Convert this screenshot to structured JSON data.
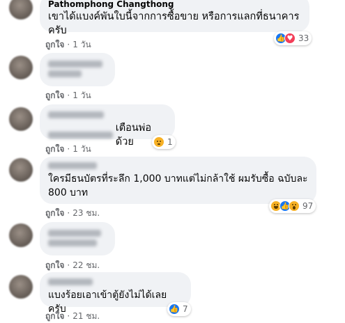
{
  "comments": [
    {
      "name": "Pathomphong Changthong",
      "text": "เขาได้แบงค์พันใบนี้จากการซื้อขาย หรือการแลกที่ธนาคารครับ",
      "like_label": "ถูกใจ",
      "time": "1 วัน",
      "reactions": [
        "like",
        "love"
      ],
      "reaction_count": "33"
    },
    {
      "name": "",
      "text": "",
      "like_label": "ถูกใจ",
      "time": "1 วัน"
    },
    {
      "name": "",
      "text": "เตือนพ่อด้วย",
      "like_label": "ถูกใจ",
      "time": "1 วัน",
      "reactions": [
        "sad"
      ],
      "reaction_count": "1"
    },
    {
      "name": "",
      "text": "ใครมีธนบัตรที่ระลึก 1,000 บาทแต่ไม่กล้าใช้ ผมรับซื้อ ฉบับละ 800 บาท",
      "like_label": "ถูกใจ",
      "time": "23 ชม.",
      "reactions": [
        "haha",
        "like",
        "wow"
      ],
      "reaction_count": "97"
    },
    {
      "name": "",
      "text": "",
      "like_label": "ถูกใจ",
      "time": "22 ชม."
    },
    {
      "name": "",
      "text": "แบงร้อยเอาเข้าตู้ยังไม่ได้เลยครับ",
      "like_label": "ถูกใจ",
      "time": "21 ชม.",
      "reactions": [
        "like"
      ],
      "reaction_count": "7"
    }
  ],
  "colors": {
    "bubble": "#f0f2f5",
    "meta": "#65676b",
    "like": "#1877f2",
    "love": "#f33e58",
    "emoji": "#f7b125"
  }
}
